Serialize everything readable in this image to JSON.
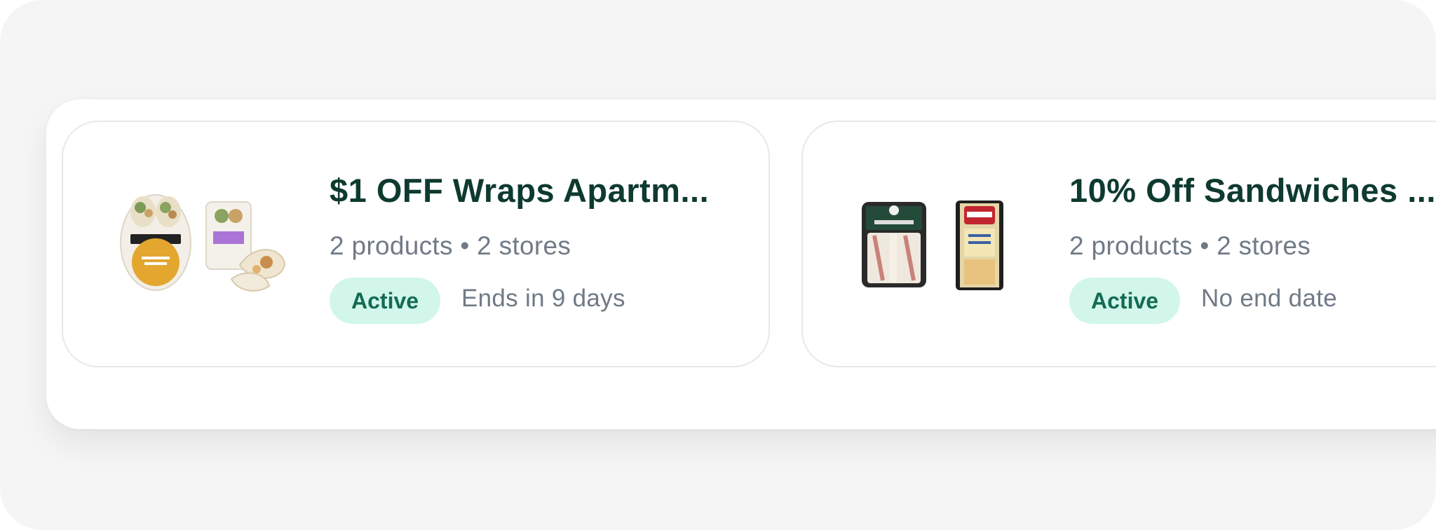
{
  "promotions": [
    {
      "title": "$1 OFF Wraps Apartm...",
      "products_stores": "2 products • 2 stores",
      "status": "Active",
      "end_text": "Ends in 9 days",
      "images": [
        "wrap-tub-product-icon",
        "wrap-pack-product-icon"
      ]
    },
    {
      "title": "10% Off Sandwiches ...",
      "products_stores": "2 products • 2 stores",
      "status": "Active",
      "end_text": "No end date",
      "images": [
        "sandwich-tray-product-icon",
        "deli-sandwich-product-icon"
      ]
    }
  ],
  "colors": {
    "title": "#0e3a2f",
    "meta": "#707a87",
    "badge_bg": "#d2f6ea",
    "badge_text": "#146b53"
  }
}
